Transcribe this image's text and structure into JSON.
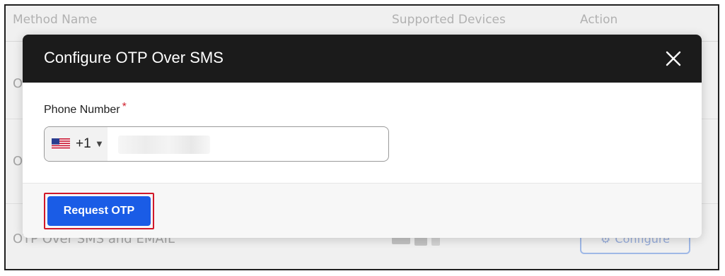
{
  "background_table": {
    "columns": [
      "Method Name",
      "Supported Devices",
      "Action"
    ],
    "rows": [
      {
        "label": "O"
      },
      {
        "label": "O"
      },
      {
        "label": "OTP Over SMS and EMAIL"
      }
    ],
    "configure_label": "Configure"
  },
  "modal": {
    "title": "Configure OTP Over SMS",
    "close_icon": "close-icon",
    "phone_label": "Phone Number",
    "required_mark": "*",
    "country_flag": "us-flag-icon",
    "dial_code": "+1",
    "phone_value": "",
    "request_label": "Request OTP"
  },
  "colors": {
    "header_bg": "#1b1b1b",
    "primary": "#1a5ce6",
    "required": "#d0232f",
    "highlight_outline": "#d1182a"
  }
}
